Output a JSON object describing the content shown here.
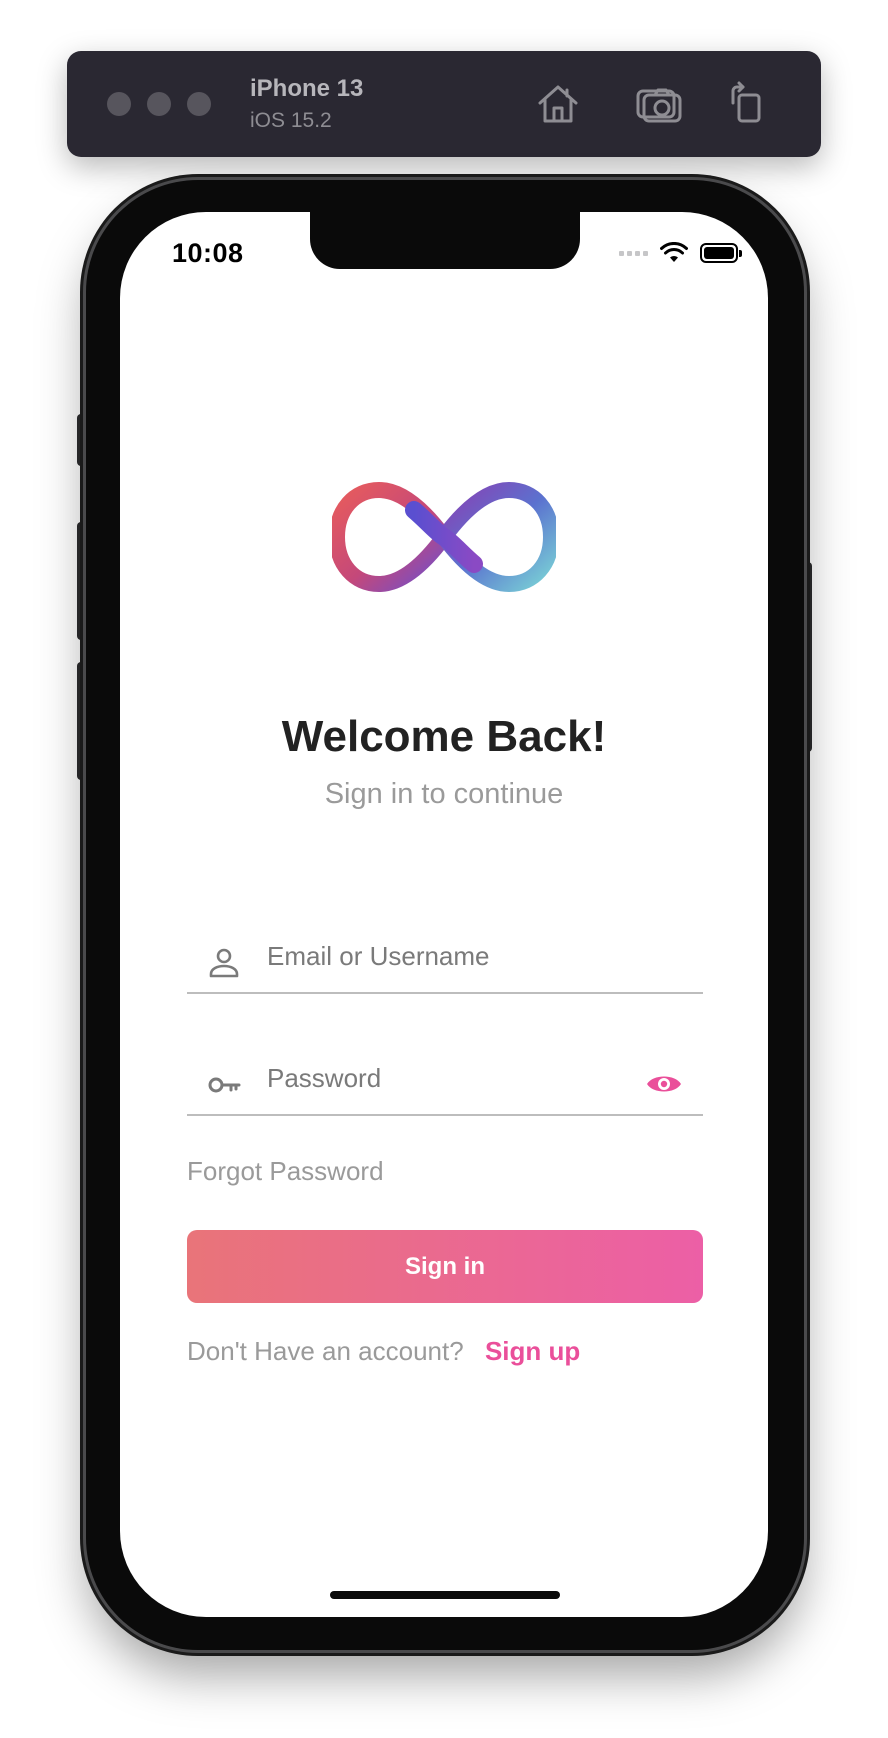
{
  "simulator": {
    "device_name": "iPhone 13",
    "os_version": "iOS 15.2",
    "toolbar_icons": [
      "home-icon",
      "screenshot-icon",
      "rotate-icon"
    ]
  },
  "status_bar": {
    "time": "10:08",
    "icons": [
      "cellular-signal-icon",
      "wifi-icon",
      "battery-icon"
    ]
  },
  "logo": {
    "icon": "infinity-logo",
    "colors": [
      "#e85c5c",
      "#6a4fd0",
      "#8a3fb3",
      "#7ad3d6"
    ]
  },
  "header": {
    "title": "Welcome Back!",
    "subtitle": "Sign in to continue"
  },
  "form": {
    "email": {
      "placeholder": "Email or Username",
      "value": "",
      "icon": "user-icon"
    },
    "password": {
      "placeholder": "Password",
      "value": "",
      "icon": "key-icon",
      "toggle_icon": "eye-icon"
    },
    "forgot_label": "Forgot Password",
    "submit_label": "Sign in"
  },
  "footer": {
    "prompt": "Don't Have an account?",
    "signup_label": "Sign up"
  },
  "theme": {
    "accent": "#ea4f9a",
    "button_gradient": [
      "#e97479",
      "#ec5fa6"
    ],
    "title_color": "#222222",
    "muted_text": "#9a9a9a"
  }
}
